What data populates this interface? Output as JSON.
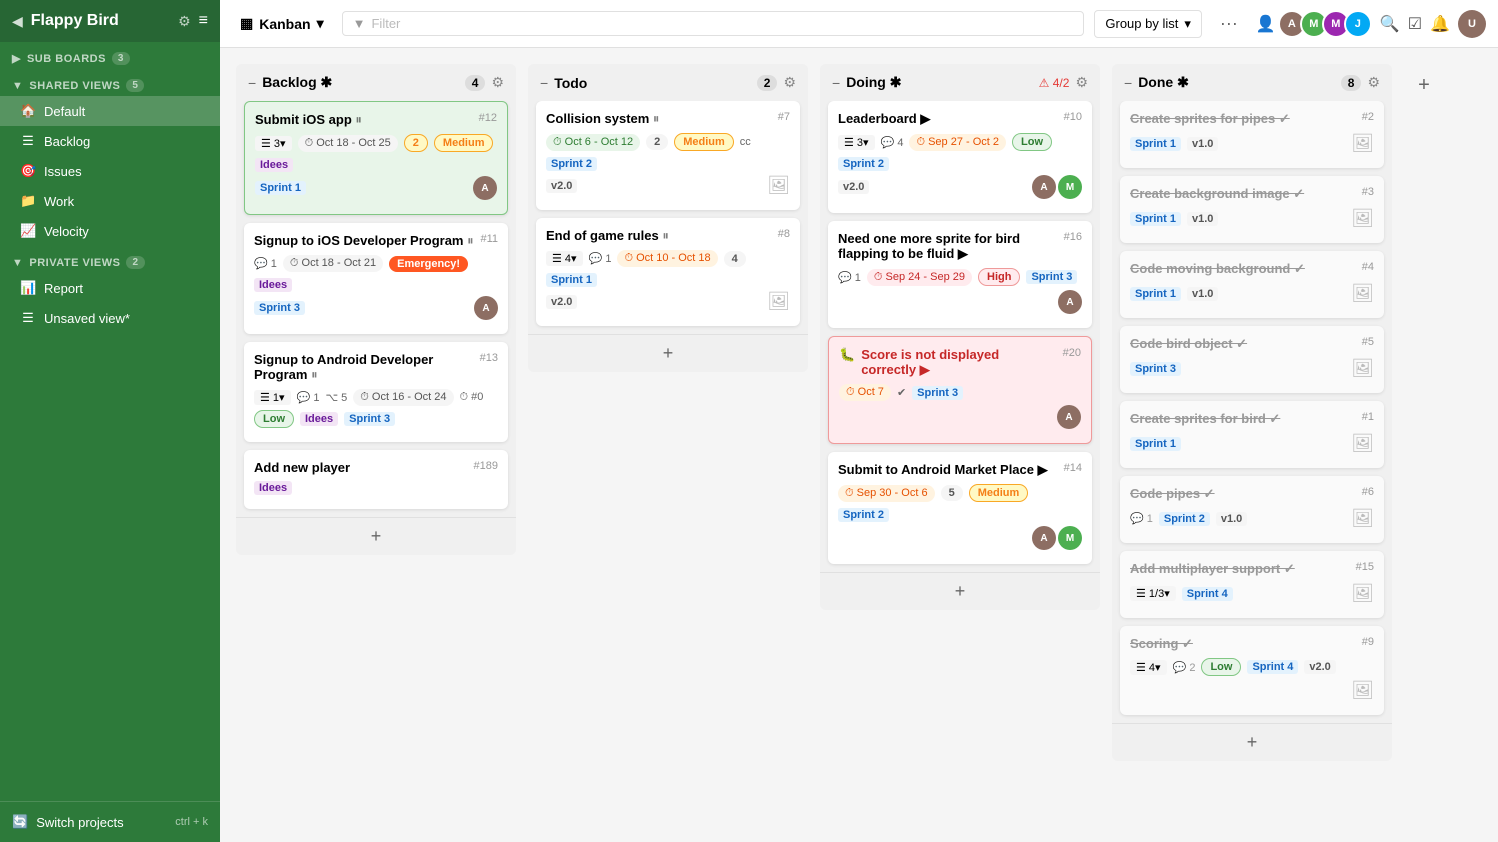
{
  "sidebar": {
    "title": "Flappy Bird",
    "subboards_label": "SUB BOARDS",
    "subboards_count": "3",
    "shared_views_label": "SHARED VIEWS",
    "shared_views_count": "5",
    "private_views_label": "PRIVATE VIEWS",
    "private_views_count": "2",
    "items_shared": [
      {
        "id": "default",
        "label": "Default",
        "icon": "🏠",
        "active": true
      },
      {
        "id": "backlog",
        "label": "Backlog",
        "icon": "☰"
      },
      {
        "id": "issues",
        "label": "Issues",
        "icon": "🎯"
      },
      {
        "id": "work",
        "label": "Work",
        "icon": "📁"
      },
      {
        "id": "velocity",
        "label": "Velocity",
        "icon": "📈"
      }
    ],
    "items_private": [
      {
        "id": "report",
        "label": "Report",
        "icon": "📊"
      },
      {
        "id": "unsaved",
        "label": "Unsaved view*",
        "icon": "☰"
      }
    ],
    "switch_projects": "Switch projects",
    "shortcut": "ctrl + k"
  },
  "topbar": {
    "view_label": "Kanban",
    "filter_placeholder": "Filter",
    "group_by_label": "Group by list",
    "dots": "..."
  },
  "board": {
    "columns": [
      {
        "id": "backlog",
        "title": "Backlog",
        "count": "4",
        "cards": [
          {
            "id": "backlog-1",
            "title": "Submit iOS app",
            "number": "#12",
            "highlighted": true,
            "checklist": "3▾",
            "date": "Oct 18 - Oct 25",
            "date_style": "gray",
            "count": "2",
            "badge": "Medium",
            "badge_type": "medium",
            "tag": "Idees",
            "sprint": "Sprint 1",
            "avatar_color": "#8d6e63",
            "has_pause_icon": true
          },
          {
            "id": "backlog-2",
            "title": "Signup to iOS Developer Program",
            "number": "#11",
            "checklist": null,
            "date": "Oct 18 - Oct 21",
            "date_style": "gray",
            "badge": "Emergency!",
            "badge_type": "emergency",
            "tag": "Idees",
            "sprint": "Sprint 3",
            "comment_count": "1",
            "avatar_color": "#8d6e63",
            "has_pause_icon": true
          },
          {
            "id": "backlog-3",
            "title": "Signup to Android Developer Program",
            "number": "#13",
            "checklist": "1▾",
            "comment_count": "1",
            "subtask_count": "5",
            "date": "Oct 16 - Oct 24",
            "date_style": "gray",
            "time": "#0",
            "badge": "Low",
            "badge_type": "low",
            "tag": "Idees",
            "sprint": "Sprint 3",
            "has_pause_icon": true
          },
          {
            "id": "backlog-4",
            "title": "Add new player",
            "number": "#189",
            "tag": "Idees"
          }
        ]
      },
      {
        "id": "todo",
        "title": "Todo",
        "count": "2",
        "cards": [
          {
            "id": "todo-1",
            "title": "Collision system",
            "number": "#7",
            "checklist": null,
            "date": "Oct 6 - Oct 12",
            "date_style": "green",
            "count": "2",
            "badge": "Medium",
            "badge_type": "medium",
            "tag": "cc",
            "sprint": "Sprint 2",
            "version": "v2.0",
            "has_pause_icon": true
          },
          {
            "id": "todo-2",
            "title": "End of game rules",
            "number": "#8",
            "checklist": "4▾",
            "comment_count": "1",
            "date": "Oct 10 - Oct 18",
            "date_style": "orange",
            "count": "4",
            "sprint": "Sprint 1",
            "version": "v2.0",
            "has_pause_icon": true
          }
        ]
      },
      {
        "id": "doing",
        "title": "Doing",
        "count": "4/2",
        "alert": true,
        "cards": [
          {
            "id": "doing-1",
            "title": "Leaderboard",
            "number": "#10",
            "checklist": "3▾",
            "comment_count": "4",
            "date": "Sep 27 - Oct 2",
            "date_style": "orange",
            "badge": "Low",
            "badge_type": "low",
            "sprint": "Sprint 2",
            "version": "v2.0",
            "avatar_color": "#8d6e63",
            "avatar2_color": "#4caf50",
            "has_play_icon": true
          },
          {
            "id": "doing-2",
            "title": "Need one more sprite for bird flapping to be fluid",
            "number": "#16",
            "comment_count": "1",
            "date": "Sep 24 - Sep 29",
            "date_style": "red",
            "badge": "High",
            "badge_type": "high",
            "sprint": "Sprint 3",
            "avatar_color": "#8d6e63",
            "has_play_icon": true
          },
          {
            "id": "doing-3",
            "title": "Score is not displayed correctly",
            "number": "#20",
            "date": "Oct 7",
            "date_style": "orange",
            "sprint": "Sprint 3",
            "avatar_color": "#8d6e63",
            "is_bug": true,
            "has_play_icon": true,
            "error_highlighted": true,
            "has_check": true
          },
          {
            "id": "doing-4",
            "title": "Submit to Android Market Place",
            "number": "#14",
            "date": "Sep 30 - Oct 6",
            "date_style": "orange",
            "count": "5",
            "badge": "Medium",
            "badge_type": "medium",
            "sprint": "Sprint 2",
            "avatar_color": "#8d6e63",
            "avatar2_color": "#4caf50",
            "has_play_icon": true
          }
        ]
      },
      {
        "id": "done",
        "title": "Done",
        "count": "8",
        "done": true,
        "cards": [
          {
            "id": "done-1",
            "title": "Create sprites for pipes",
            "number": "#2",
            "sprint": "Sprint 1",
            "version": "v1.0",
            "has_check": true
          },
          {
            "id": "done-2",
            "title": "Create background image",
            "number": "#3",
            "sprint": "Sprint 1",
            "version": "v1.0",
            "has_check": true
          },
          {
            "id": "done-3",
            "title": "Code moving background",
            "number": "#4",
            "sprint": "Sprint 1",
            "version": "v1.0",
            "has_check": true
          },
          {
            "id": "done-4",
            "title": "Code bird object",
            "number": "#5",
            "sprint": "Sprint 3",
            "has_check": true
          },
          {
            "id": "done-5",
            "title": "Create sprites for bird",
            "number": "#1",
            "sprint": "Sprint 1",
            "has_check": true
          },
          {
            "id": "done-6",
            "title": "Code pipes",
            "number": "#6",
            "comment_count": "1",
            "sprint": "Sprint 2",
            "version": "v1.0",
            "has_check": true
          },
          {
            "id": "done-7",
            "title": "Add multiplayer support",
            "number": "#15",
            "checklist": "1/3▾",
            "sprint": "Sprint 4",
            "has_check": true
          },
          {
            "id": "done-8",
            "title": "Scoring",
            "number": "#9",
            "checklist": "4▾",
            "comment_count": "2",
            "badge": "Low",
            "badge_type": "low",
            "sprint": "Sprint 4",
            "version": "v2.0",
            "has_check": true
          }
        ]
      }
    ]
  },
  "icons": {
    "back_arrow": "◀",
    "gear": "⚙",
    "menu": "≡",
    "kanban_icon": "▦",
    "filter_icon": "▼",
    "dropdown_arrow": "▾",
    "search": "🔍",
    "bell": "🔔",
    "add_member": "👤+",
    "minus": "−",
    "settings": "⚙",
    "plus": "+"
  }
}
